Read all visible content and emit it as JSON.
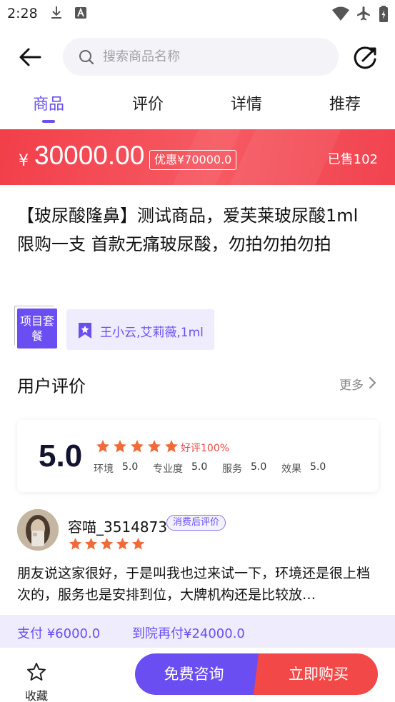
{
  "status_bar": {
    "time": "2:28"
  },
  "search": {
    "placeholder": "搜索商品名称"
  },
  "tabs": [
    {
      "label": "商品",
      "active": true
    },
    {
      "label": "评价",
      "active": false
    },
    {
      "label": "详情",
      "active": false
    },
    {
      "label": "推荐",
      "active": false
    }
  ],
  "price": {
    "currency": "¥",
    "value": "30000.00",
    "discount": "优惠¥70000.0",
    "sold": "已售102"
  },
  "product": {
    "title": "【玻尿酸隆鼻】测试商品，爱芙莱玻尿酸1ml 限购一支 首款无痛玻尿酸，勿拍勿拍勿拍",
    "tag_type": "项目套餐",
    "tag_text": "王小云,艾莉薇,1ml"
  },
  "reviews": {
    "section_title": "用户评价",
    "more_label": "更多",
    "score": "5.0",
    "star_count": 5,
    "good_rate": "好评100%",
    "sub_scores": [
      {
        "label": "环境",
        "value": "5.0"
      },
      {
        "label": "专业度",
        "value": "5.0"
      },
      {
        "label": "服务",
        "value": "5.0"
      },
      {
        "label": "效果",
        "value": "5.0"
      }
    ],
    "items": [
      {
        "user": "容喵_3514873",
        "badge": "消费后评价",
        "stars": 5,
        "text": "朋友说这家很好，于是叫我也过来试一下，环境还是很上档次的，服务也是安排到位，大牌机构还是比较放…"
      }
    ]
  },
  "payment": {
    "pay_now": "支付 ¥6000.0",
    "pay_later": "到院再付¥24000.0"
  },
  "bottom_bar": {
    "favorite": "收藏",
    "consult": "免费咨询",
    "buy": "立即购买"
  },
  "colors": {
    "accent": "#6b4ef2",
    "price_red": "#f23f4a",
    "buy_red": "#f24848",
    "star_orange": "#f06a3a"
  }
}
